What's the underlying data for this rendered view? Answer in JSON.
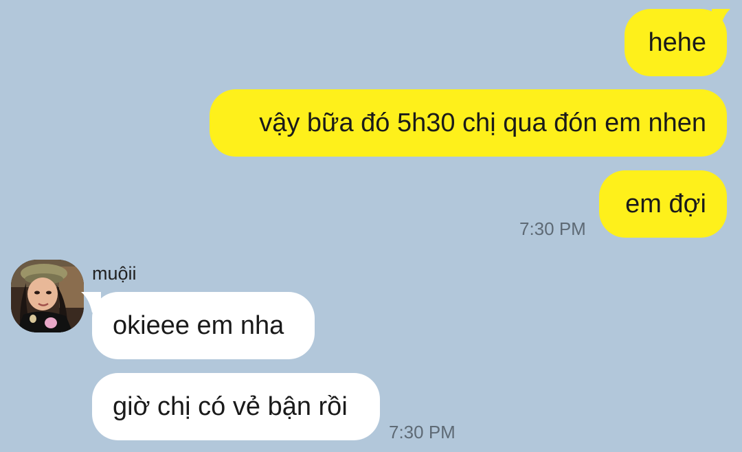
{
  "conversation": {
    "outgoing": [
      {
        "text": "hehe"
      },
      {
        "text": "vậy bữa đó 5h30 chị qua đón em nhen"
      },
      {
        "text": "em đợi"
      }
    ],
    "outgoing_time": "7:30 PM",
    "incoming_sender": "muộii",
    "incoming": [
      {
        "text": "okieee em nha"
      },
      {
        "text": "giờ chị có vẻ bận rồi"
      }
    ],
    "incoming_time": "7:30 PM"
  },
  "colors": {
    "background": "#b2c7da",
    "outgoing_bubble": "#fef01b",
    "incoming_bubble": "#ffffff",
    "timestamp": "#5e6a75"
  },
  "icons": {
    "avatar": "profile-photo"
  }
}
